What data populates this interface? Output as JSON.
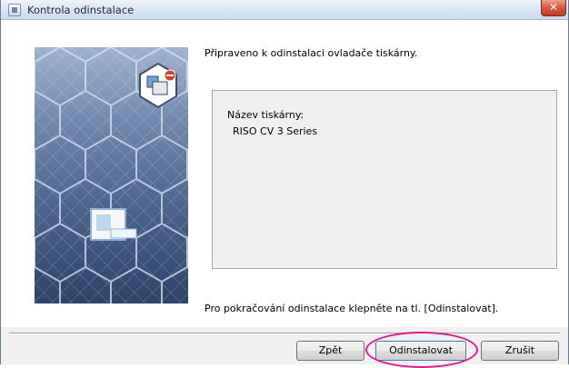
{
  "window": {
    "title": "Kontrola odinstalace",
    "close_label": "✕"
  },
  "main": {
    "intro": "Připraveno k odinstalaci ovladače tiskárny.",
    "printer_name_label": "Název tiskárny:",
    "printer_name_value": "RISO CV 3 Series",
    "footer": "Pro pokračování odinstalace klepněte na tl. [Odinstalovat]."
  },
  "buttons": {
    "back": "Zpět",
    "uninstall": "Odinstalovat",
    "cancel": "Zrušit"
  },
  "icons": {
    "app": "installer-icon",
    "close": "close-icon",
    "side_image": "hexagon-printer-illustration"
  },
  "colors": {
    "highlight": "#e0168c",
    "close_button": "#c43a23"
  }
}
